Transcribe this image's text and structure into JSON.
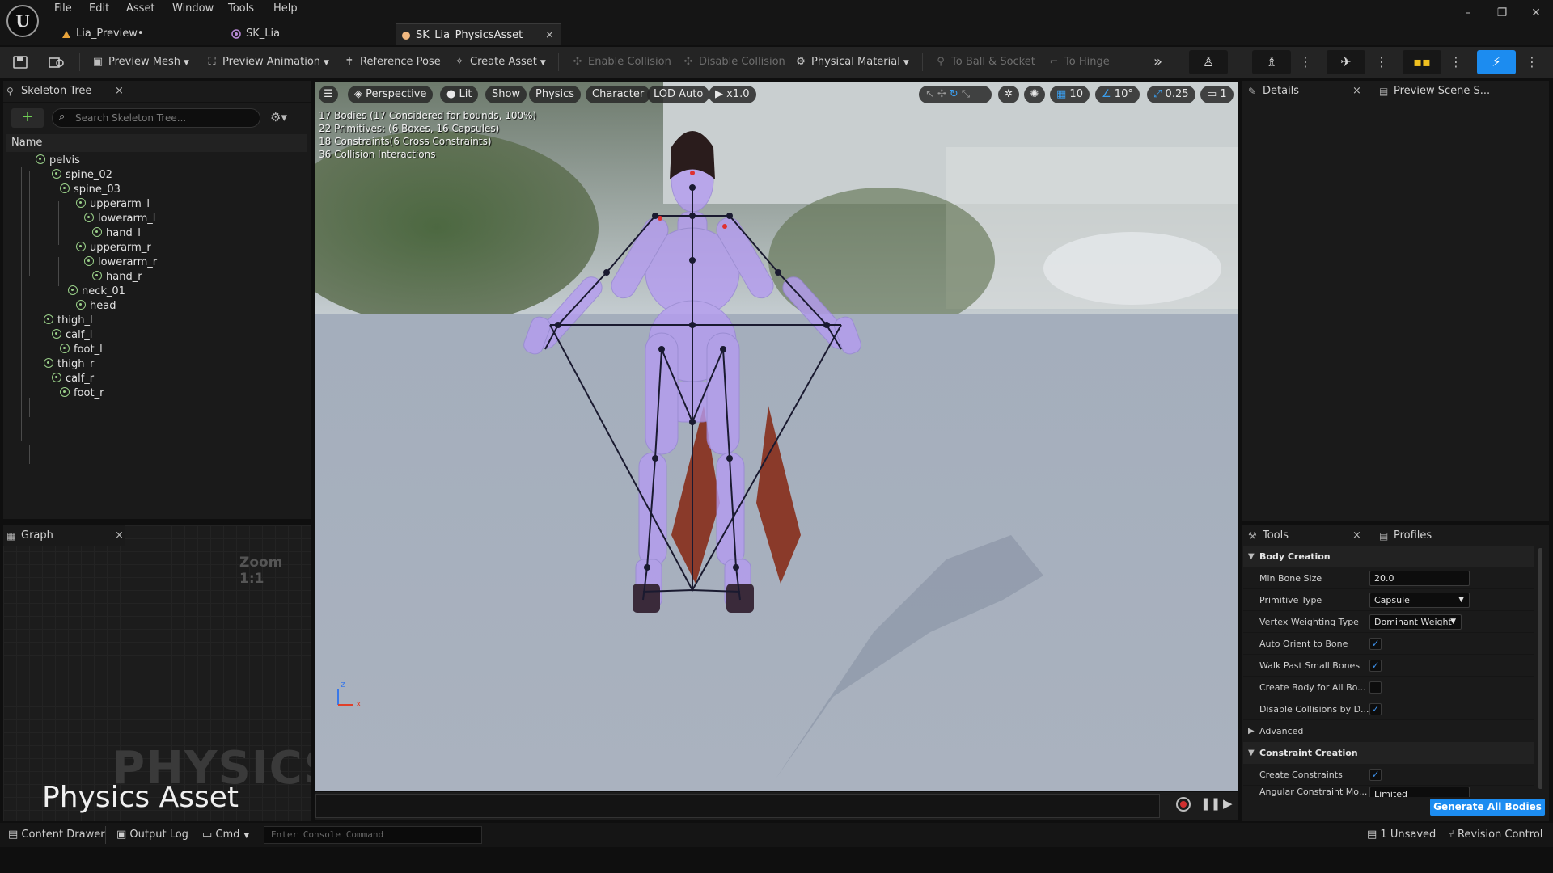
{
  "menu": [
    "File",
    "Edit",
    "Asset",
    "Window",
    "Tools",
    "Help"
  ],
  "doc_tabs": [
    {
      "label": "Lia_Preview•"
    },
    {
      "label": "SK_Lia"
    },
    {
      "label": "SK_Lia_PhysicsAsset",
      "close": "×"
    }
  ],
  "window_controls": {
    "minimize": "–",
    "restore": "❐",
    "close": "✕"
  },
  "toolbar": {
    "preview_mesh": "Preview Mesh",
    "preview_animation": "Preview Animation",
    "reference_pose": "Reference Pose",
    "create_asset": "Create Asset",
    "enable_collision": "Enable Collision",
    "disable_collision": "Disable Collision",
    "physical_material": "Physical Material",
    "to_ball_socket": "To Ball & Socket",
    "to_hinge": "To Hinge"
  },
  "skeleton_tree": {
    "title": "Skeleton Tree",
    "search_placeholder": "Search Skeleton Tree...",
    "column_name": "Name",
    "bones": [
      {
        "name": "pelvis"
      },
      {
        "name": "spine_02"
      },
      {
        "name": "spine_03"
      },
      {
        "name": "upperarm_l"
      },
      {
        "name": "lowerarm_l"
      },
      {
        "name": "hand_l"
      },
      {
        "name": "upperarm_r"
      },
      {
        "name": "lowerarm_r"
      },
      {
        "name": "hand_r"
      },
      {
        "name": "neck_01"
      },
      {
        "name": "head"
      },
      {
        "name": "thigh_l"
      },
      {
        "name": "calf_l"
      },
      {
        "name": "foot_l"
      },
      {
        "name": "thigh_r"
      },
      {
        "name": "calf_r"
      },
      {
        "name": "foot_r"
      }
    ]
  },
  "graph": {
    "title": "Graph",
    "zoom": "Zoom 1:1",
    "watermark": "PHYSICS",
    "asset_type": "Physics Asset"
  },
  "viewport": {
    "perspective": "Perspective",
    "lit": "Lit",
    "show": "Show",
    "physics": "Physics",
    "character": "Character",
    "lod": "LOD Auto",
    "play_rate": "x1.0",
    "grid_snap": "10",
    "rot_snap": "10°",
    "scale_snap": "0.25",
    "cam_speed": "1",
    "stats": [
      "17 Bodies (17 Considered for bounds, 100%)",
      "22 Primitives: (6 Boxes, 16 Capsules)",
      "18 Constraints(6 Cross Constraints)",
      "36 Collision Interactions"
    ],
    "axis_x": "x",
    "axis_z": "z"
  },
  "details": {
    "title": "Details",
    "preview_scene": "Preview Scene S..."
  },
  "tools": {
    "title": "Tools",
    "profiles": "Profiles",
    "body_creation": "Body Creation",
    "min_bone_size_label": "Min Bone Size",
    "min_bone_size": "20.0",
    "primitive_type_label": "Primitive Type",
    "primitive_type": "Capsule",
    "vertex_weighting_label": "Vertex Weighting Type",
    "vertex_weighting": "Dominant Weight",
    "auto_orient_label": "Auto Orient to Bone",
    "auto_orient": true,
    "walk_past_label": "Walk Past Small Bones",
    "walk_past": true,
    "create_body_all_label": "Create Body for All Bo...",
    "create_body_all": false,
    "disable_collisions_label": "Disable Collisions by D...",
    "disable_collisions": true,
    "advanced": "Advanced",
    "constraint_creation": "Constraint Creation",
    "create_constraints_label": "Create Constraints",
    "create_constraints": true,
    "angular_constraint_label": "Angular Constraint Mo...",
    "angular_constraint": "Limited",
    "generate_button": "Generate All Bodies"
  },
  "statusbar": {
    "content_drawer": "Content Drawer",
    "output_log": "Output Log",
    "cmd": "Cmd",
    "console_placeholder": "Enter Console Command",
    "unsaved": "1 Unsaved",
    "revision_control": "Revision Control"
  },
  "colors": {
    "accent": "#1c8cf0",
    "bone_icon": "#9ad089",
    "body_overlay": "#b49cf0"
  }
}
